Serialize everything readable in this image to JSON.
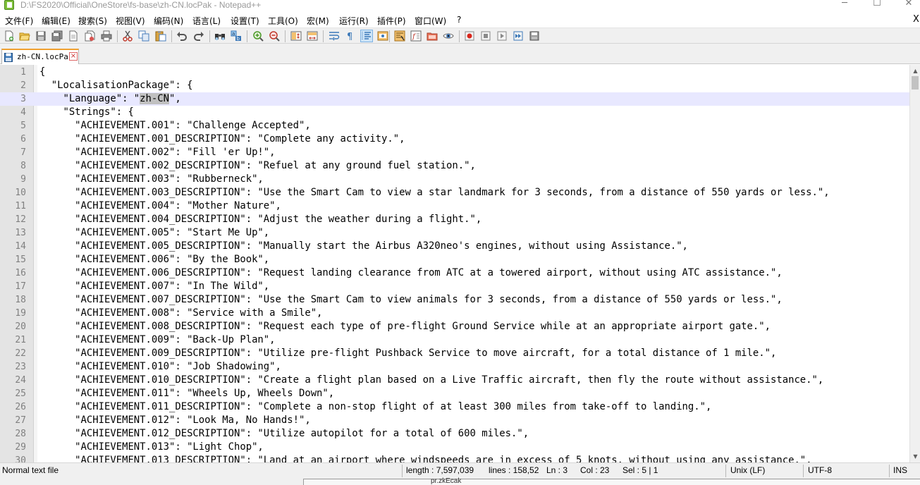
{
  "window": {
    "title": "D:\\FS2020\\Official\\OneStore\\fs-base\\zh-CN.locPak - Notepad++",
    "min_glyph": "─",
    "max_glyph": "☐",
    "close_glyph": "✕"
  },
  "menu": {
    "items": [
      "文件(F)",
      "编辑(E)",
      "搜索(S)",
      "视图(V)",
      "编码(N)",
      "语言(L)",
      "设置(T)",
      "工具(O)",
      "宏(M)",
      "运行(R)",
      "插件(P)",
      "窗口(W)",
      "?"
    ],
    "close_label": "X"
  },
  "toolbar": {
    "buttons": [
      "new-file",
      "open-file",
      "save",
      "save-all",
      "close",
      "close-all",
      "print",
      "cut",
      "copy",
      "paste",
      "undo",
      "redo",
      "find",
      "replace",
      "zoom-in",
      "zoom-out",
      "sync-vertical",
      "sync-horizontal",
      "word-wrap",
      "show-all-chars",
      "indent-guide",
      "user-defined-language",
      "document-map",
      "function-list",
      "folder-as-workspace",
      "monitoring",
      "record-macro",
      "stop-recording",
      "playback-macro",
      "run-macro-multiple",
      "save-macro"
    ]
  },
  "tab": {
    "label": "zh-CN.locPak",
    "close_glyph": "×"
  },
  "editor": {
    "current_line": 3,
    "lines": [
      {
        "n": "1",
        "text": "{"
      },
      {
        "n": "2",
        "text": "  \"LocalisationPackage\": {"
      },
      {
        "n": "3",
        "pre": "    \"Language\": \"",
        "sel": "zh-CN",
        "post": "\","
      },
      {
        "n": "4",
        "text": "    \"Strings\": {"
      },
      {
        "n": "5",
        "text": "      \"ACHIEVEMENT.001\": \"Challenge Accepted\","
      },
      {
        "n": "6",
        "text": "      \"ACHIEVEMENT.001_DESCRIPTION\": \"Complete any activity.\","
      },
      {
        "n": "7",
        "text": "      \"ACHIEVEMENT.002\": \"Fill 'er Up!\","
      },
      {
        "n": "8",
        "text": "      \"ACHIEVEMENT.002_DESCRIPTION\": \"Refuel at any ground fuel station.\","
      },
      {
        "n": "9",
        "text": "      \"ACHIEVEMENT.003\": \"Rubberneck\","
      },
      {
        "n": "10",
        "text": "      \"ACHIEVEMENT.003_DESCRIPTION\": \"Use the Smart Cam to view a star landmark for 3 seconds, from a distance of 550 yards or less.\","
      },
      {
        "n": "11",
        "text": "      \"ACHIEVEMENT.004\": \"Mother Nature\","
      },
      {
        "n": "12",
        "text": "      \"ACHIEVEMENT.004_DESCRIPTION\": \"Adjust the weather during a flight.\","
      },
      {
        "n": "13",
        "text": "      \"ACHIEVEMENT.005\": \"Start Me Up\","
      },
      {
        "n": "14",
        "text": "      \"ACHIEVEMENT.005_DESCRIPTION\": \"Manually start the Airbus A320neo's engines, without using Assistance.\","
      },
      {
        "n": "15",
        "text": "      \"ACHIEVEMENT.006\": \"By the Book\","
      },
      {
        "n": "16",
        "text": "      \"ACHIEVEMENT.006_DESCRIPTION\": \"Request landing clearance from ATC at a towered airport, without using ATC assistance.\","
      },
      {
        "n": "17",
        "text": "      \"ACHIEVEMENT.007\": \"In The Wild\","
      },
      {
        "n": "18",
        "text": "      \"ACHIEVEMENT.007_DESCRIPTION\": \"Use the Smart Cam to view animals for 3 seconds, from a distance of 550 yards or less.\","
      },
      {
        "n": "19",
        "text": "      \"ACHIEVEMENT.008\": \"Service with a Smile\","
      },
      {
        "n": "20",
        "text": "      \"ACHIEVEMENT.008_DESCRIPTION\": \"Request each type of pre-flight Ground Service while at an appropriate airport gate.\","
      },
      {
        "n": "21",
        "text": "      \"ACHIEVEMENT.009\": \"Back-Up Plan\","
      },
      {
        "n": "22",
        "text": "      \"ACHIEVEMENT.009_DESCRIPTION\": \"Utilize pre-flight Pushback Service to move aircraft, for a total distance of 1 mile.\","
      },
      {
        "n": "23",
        "text": "      \"ACHIEVEMENT.010\": \"Job Shadowing\","
      },
      {
        "n": "24",
        "text": "      \"ACHIEVEMENT.010_DESCRIPTION\": \"Create a flight plan based on a Live Traffic aircraft, then fly the route without assistance.\","
      },
      {
        "n": "25",
        "text": "      \"ACHIEVEMENT.011\": \"Wheels Up, Wheels Down\","
      },
      {
        "n": "26",
        "text": "      \"ACHIEVEMENT.011_DESCRIPTION\": \"Complete a non-stop flight of at least 300 miles from take-off to landing.\","
      },
      {
        "n": "27",
        "text": "      \"ACHIEVEMENT.012\": \"Look Ma, No Hands!\","
      },
      {
        "n": "28",
        "text": "      \"ACHIEVEMENT.012_DESCRIPTION\": \"Utilize autopilot for a total of 600 miles.\","
      },
      {
        "n": "29",
        "text": "      \"ACHIEVEMENT.013\": \"Light Chop\","
      },
      {
        "n": "30",
        "text": "      \"ACHIEVEMENT.013_DESCRIPTION\": \"Land at an airport where windspeeds are in excess of 5 knots, without using any assistance.\","
      }
    ]
  },
  "statusbar": {
    "file_type": "Normal text file",
    "length": "length : 7,597,039",
    "lines": "lines : 158,52",
    "ln": "Ln : 3",
    "col": "Col : 23",
    "sel": "Sel : 5 | 1",
    "eol": "Unix (LF)",
    "encoding": "UTF-8",
    "mode": "INS",
    "below_text": "pr.zkEcak"
  },
  "colors": {
    "current_line_bg": "#e8e8ff",
    "selection_bg": "#c0c0c0",
    "tab_top_accent": "#f0a030",
    "gutter_bg": "#e4e4e4"
  }
}
